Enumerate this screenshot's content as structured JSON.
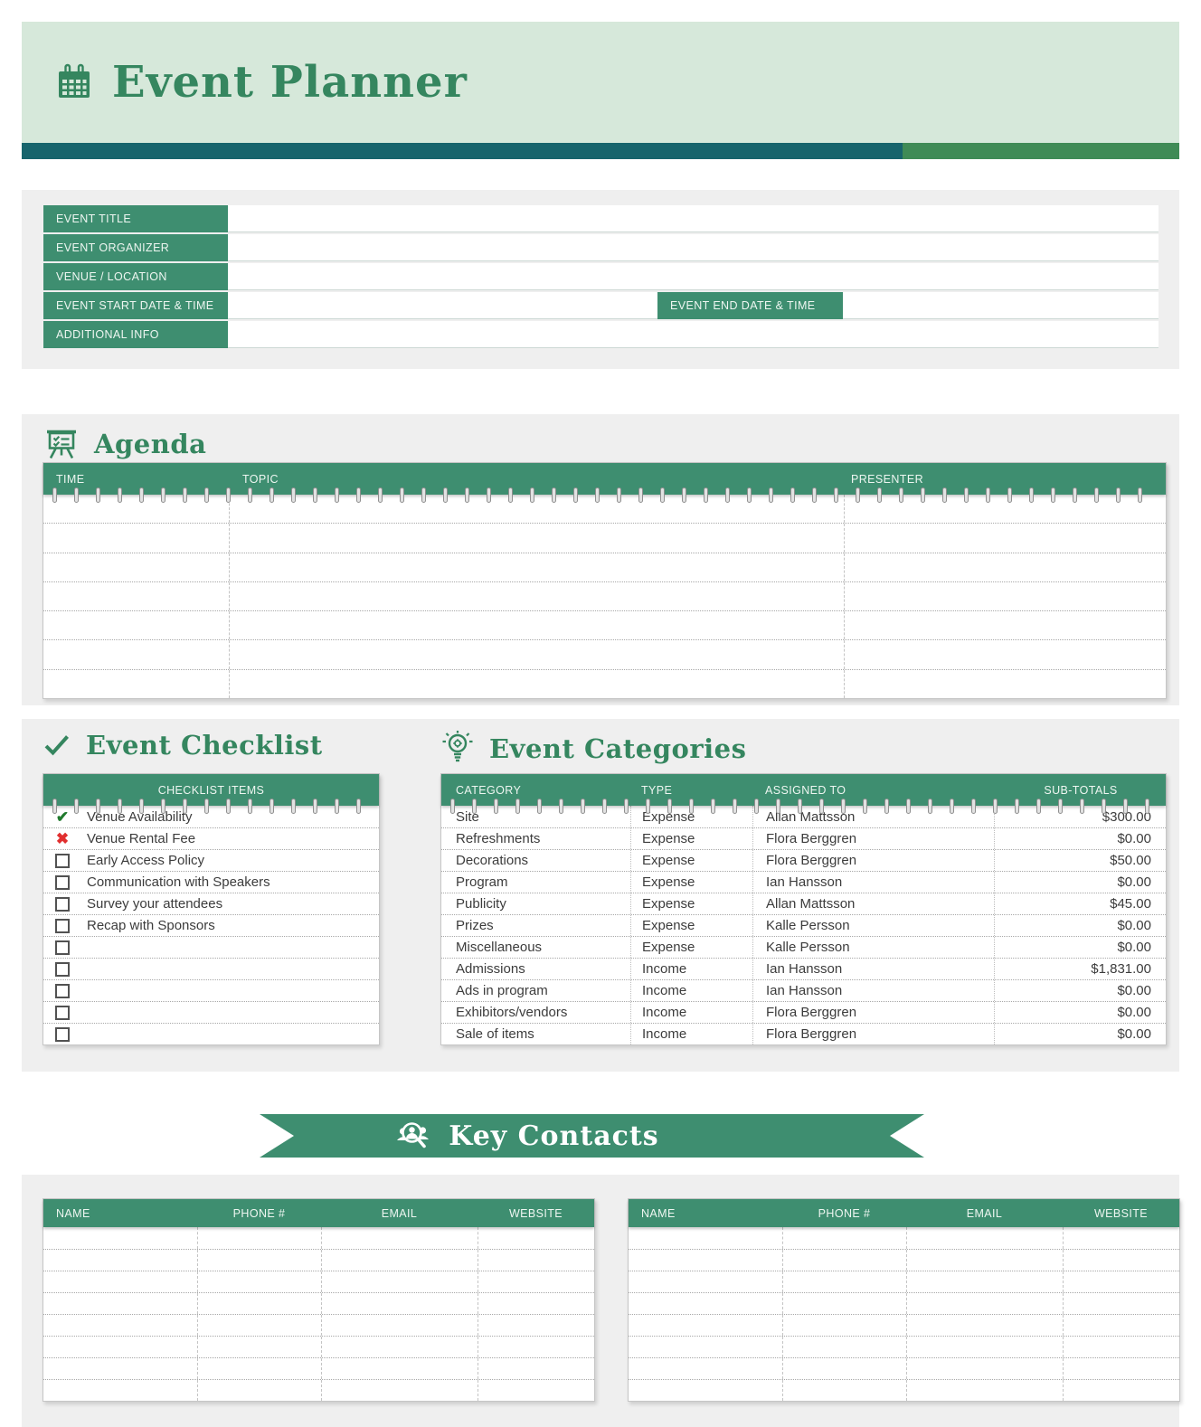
{
  "colors": {
    "banner_bg": "#d6e8da",
    "accent_green": "#35865f",
    "teal_bar": "#17646c",
    "green_bar": "#3f8b56",
    "table_header_green": "#3e8e70",
    "check_green": "#217a2e",
    "cross_red": "#e12f2f"
  },
  "header": {
    "title": "Event Planner"
  },
  "event_info": {
    "labels": [
      "EVENT TITLE",
      "EVENT ORGANIZER",
      "VENUE / LOCATION",
      "EVENT START DATE & TIME",
      "ADDITIONAL INFO"
    ],
    "end_label": "EVENT END DATE & TIME"
  },
  "agenda": {
    "title": "Agenda",
    "columns": [
      "TIME",
      "TOPIC",
      "PRESENTER"
    ],
    "empty_rows": 7
  },
  "checklist": {
    "title": "Event Checklist",
    "header": "CHECKLIST ITEMS",
    "marks": {
      "checked": "✔",
      "crossed": "✖"
    },
    "items": [
      {
        "state": "checked",
        "label": "Venue Availability"
      },
      {
        "state": "crossed",
        "label": "Venue Rental Fee"
      },
      {
        "state": "unchecked",
        "label": "Early Access Policy"
      },
      {
        "state": "unchecked",
        "label": "Communication with Speakers"
      },
      {
        "state": "unchecked",
        "label": "Survey your attendees"
      },
      {
        "state": "unchecked",
        "label": "Recap with Sponsors"
      },
      {
        "state": "unchecked",
        "label": ""
      },
      {
        "state": "unchecked",
        "label": ""
      },
      {
        "state": "unchecked",
        "label": ""
      },
      {
        "state": "unchecked",
        "label": ""
      },
      {
        "state": "unchecked",
        "label": ""
      }
    ]
  },
  "categories": {
    "title": "Event Categories",
    "columns": [
      "CATEGORY",
      "TYPE",
      "ASSIGNED TO",
      "SUB-TOTALS"
    ],
    "rows": [
      [
        "Site",
        "Expense",
        "Allan Mattsson",
        "$300.00"
      ],
      [
        "Refreshments",
        "Expense",
        "Flora Berggren",
        "$0.00"
      ],
      [
        "Decorations",
        "Expense",
        "Flora Berggren",
        "$50.00"
      ],
      [
        "Program",
        "Expense",
        "Ian Hansson",
        "$0.00"
      ],
      [
        "Publicity",
        "Expense",
        "Allan Mattsson",
        "$45.00"
      ],
      [
        "Prizes",
        "Expense",
        "Kalle Persson",
        "$0.00"
      ],
      [
        "Miscellaneous",
        "Expense",
        "Kalle Persson",
        "$0.00"
      ],
      [
        "Admissions",
        "Income",
        "Ian Hansson",
        "$1,831.00"
      ],
      [
        "Ads in program",
        "Income",
        "Ian Hansson",
        "$0.00"
      ],
      [
        "Exhibitors/vendors",
        "Income",
        "Flora Berggren",
        "$0.00"
      ],
      [
        "Sale of items",
        "Income",
        "Flora Berggren",
        "$0.00"
      ]
    ]
  },
  "key_contacts": {
    "title": "Key Contacts",
    "columns": [
      "NAME",
      "PHONE #",
      "EMAIL",
      "WEBSITE"
    ],
    "empty_rows": 8
  }
}
